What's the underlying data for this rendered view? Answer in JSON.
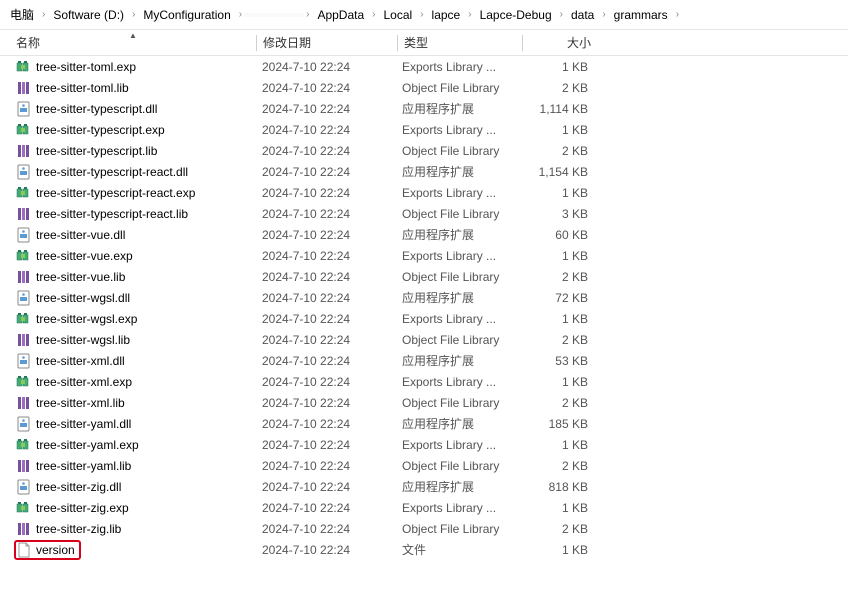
{
  "breadcrumb": [
    "电脑",
    "Software (D:)",
    "MyConfiguration",
    "",
    "AppData",
    "Local",
    "lapce",
    "Lapce-Debug",
    "data",
    "grammars"
  ],
  "columns": {
    "name": "名称",
    "date": "修改日期",
    "type": "类型",
    "size": "大小"
  },
  "files": [
    {
      "name": "tree-sitter-toml.exp",
      "date": "2024-7-10 22:24",
      "type": "Exports Library ...",
      "size": "1 KB",
      "icon": "exp"
    },
    {
      "name": "tree-sitter-toml.lib",
      "date": "2024-7-10 22:24",
      "type": "Object File Library",
      "size": "2 KB",
      "icon": "lib"
    },
    {
      "name": "tree-sitter-typescript.dll",
      "date": "2024-7-10 22:24",
      "type": "应用程序扩展",
      "size": "1,114 KB",
      "icon": "dll"
    },
    {
      "name": "tree-sitter-typescript.exp",
      "date": "2024-7-10 22:24",
      "type": "Exports Library ...",
      "size": "1 KB",
      "icon": "exp"
    },
    {
      "name": "tree-sitter-typescript.lib",
      "date": "2024-7-10 22:24",
      "type": "Object File Library",
      "size": "2 KB",
      "icon": "lib"
    },
    {
      "name": "tree-sitter-typescript-react.dll",
      "date": "2024-7-10 22:24",
      "type": "应用程序扩展",
      "size": "1,154 KB",
      "icon": "dll"
    },
    {
      "name": "tree-sitter-typescript-react.exp",
      "date": "2024-7-10 22:24",
      "type": "Exports Library ...",
      "size": "1 KB",
      "icon": "exp"
    },
    {
      "name": "tree-sitter-typescript-react.lib",
      "date": "2024-7-10 22:24",
      "type": "Object File Library",
      "size": "3 KB",
      "icon": "lib"
    },
    {
      "name": "tree-sitter-vue.dll",
      "date": "2024-7-10 22:24",
      "type": "应用程序扩展",
      "size": "60 KB",
      "icon": "dll"
    },
    {
      "name": "tree-sitter-vue.exp",
      "date": "2024-7-10 22:24",
      "type": "Exports Library ...",
      "size": "1 KB",
      "icon": "exp"
    },
    {
      "name": "tree-sitter-vue.lib",
      "date": "2024-7-10 22:24",
      "type": "Object File Library",
      "size": "2 KB",
      "icon": "lib"
    },
    {
      "name": "tree-sitter-wgsl.dll",
      "date": "2024-7-10 22:24",
      "type": "应用程序扩展",
      "size": "72 KB",
      "icon": "dll"
    },
    {
      "name": "tree-sitter-wgsl.exp",
      "date": "2024-7-10 22:24",
      "type": "Exports Library ...",
      "size": "1 KB",
      "icon": "exp"
    },
    {
      "name": "tree-sitter-wgsl.lib",
      "date": "2024-7-10 22:24",
      "type": "Object File Library",
      "size": "2 KB",
      "icon": "lib"
    },
    {
      "name": "tree-sitter-xml.dll",
      "date": "2024-7-10 22:24",
      "type": "应用程序扩展",
      "size": "53 KB",
      "icon": "dll"
    },
    {
      "name": "tree-sitter-xml.exp",
      "date": "2024-7-10 22:24",
      "type": "Exports Library ...",
      "size": "1 KB",
      "icon": "exp"
    },
    {
      "name": "tree-sitter-xml.lib",
      "date": "2024-7-10 22:24",
      "type": "Object File Library",
      "size": "2 KB",
      "icon": "lib"
    },
    {
      "name": "tree-sitter-yaml.dll",
      "date": "2024-7-10 22:24",
      "type": "应用程序扩展",
      "size": "185 KB",
      "icon": "dll"
    },
    {
      "name": "tree-sitter-yaml.exp",
      "date": "2024-7-10 22:24",
      "type": "Exports Library ...",
      "size": "1 KB",
      "icon": "exp"
    },
    {
      "name": "tree-sitter-yaml.lib",
      "date": "2024-7-10 22:24",
      "type": "Object File Library",
      "size": "2 KB",
      "icon": "lib"
    },
    {
      "name": "tree-sitter-zig.dll",
      "date": "2024-7-10 22:24",
      "type": "应用程序扩展",
      "size": "818 KB",
      "icon": "dll"
    },
    {
      "name": "tree-sitter-zig.exp",
      "date": "2024-7-10 22:24",
      "type": "Exports Library ...",
      "size": "1 KB",
      "icon": "exp"
    },
    {
      "name": "tree-sitter-zig.lib",
      "date": "2024-7-10 22:24",
      "type": "Object File Library",
      "size": "2 KB",
      "icon": "lib"
    },
    {
      "name": "version",
      "date": "2024-7-10 22:24",
      "type": "文件",
      "size": "1 KB",
      "icon": "file",
      "highlight": true
    }
  ]
}
